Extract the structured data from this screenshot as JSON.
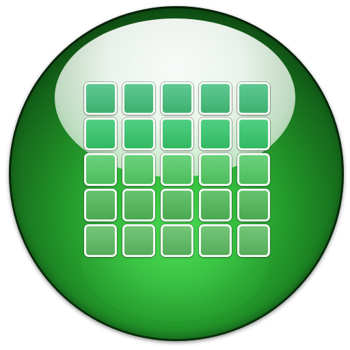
{
  "icon": {
    "name": "calendar-grid-orb-icon",
    "accent_color": "#2fb338",
    "dark_edge_color": "#041506",
    "cell_border_color": "#f3f8f3",
    "rows": 5,
    "columns": 5
  }
}
